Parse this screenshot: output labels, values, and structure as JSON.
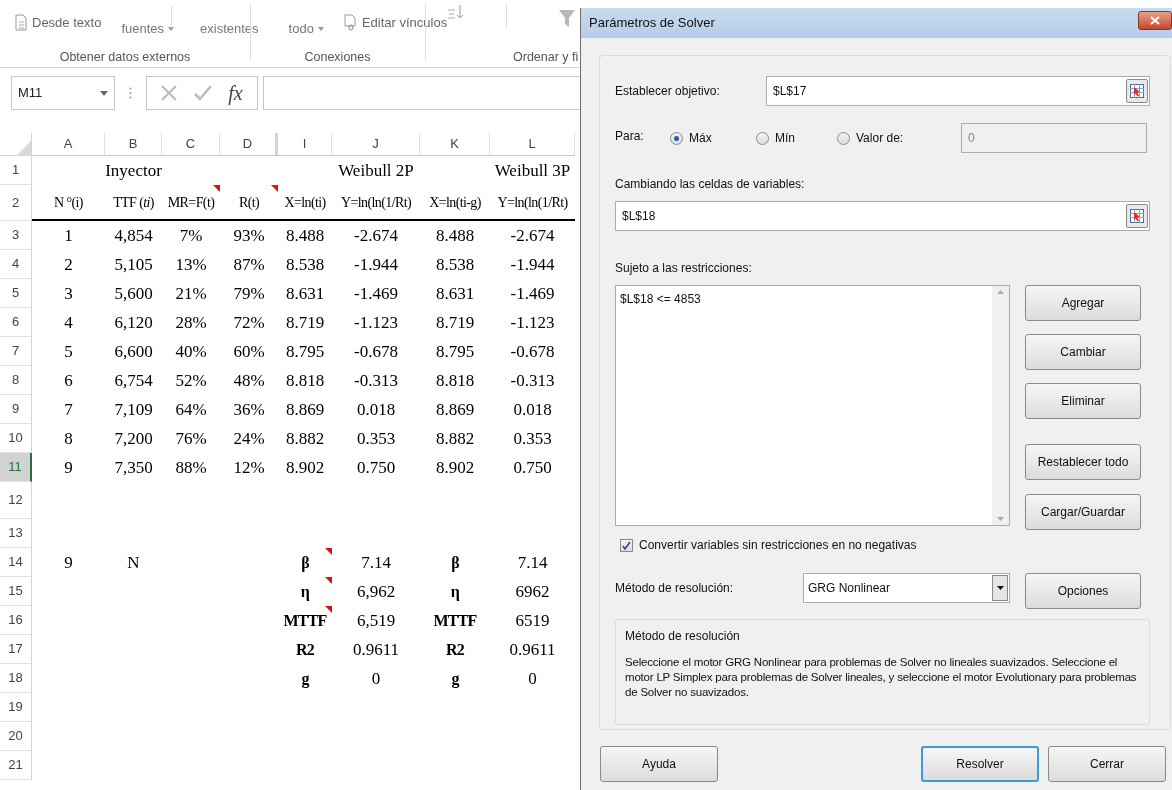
{
  "ribbon": {
    "items": [
      {
        "kind": "document",
        "label": "Desde texto"
      },
      {
        "kind": "dropdown",
        "label": "fuentes"
      },
      {
        "kind": "plain",
        "label": "existentes"
      },
      {
        "kind": "dropdown",
        "label": "todo"
      },
      {
        "kind": "link",
        "label": "Editar vínculos"
      },
      {
        "kind": "sort"
      },
      {
        "kind": "filter"
      }
    ],
    "groups": [
      "Obtener datos externos",
      "Conexiones",
      "Ordenar y fi"
    ]
  },
  "formula_bar": {
    "name_box": "M11",
    "function_symbol": "fx"
  },
  "sheet": {
    "columns": [
      "A",
      "B",
      "C",
      "D",
      "I",
      "J",
      "K",
      "L"
    ],
    "rows": [
      {
        "number": "1",
        "selected": false,
        "kind": "title",
        "cells": [
          "",
          "Inyector",
          "",
          "",
          "",
          "Weibull 2P",
          "",
          "Weibull 3P"
        ]
      },
      {
        "number": "2",
        "selected": false,
        "kind": "header",
        "cells": [
          "N °(i)",
          "TTF (*ti*)",
          {
            "text": "MR=F(t)",
            "kind": "commented"
          },
          {
            "text": "R(t)",
            "kind": "commented"
          },
          "X=ln(ti)",
          "Y=ln(ln(1/Rt)",
          "X=ln(ti-g)",
          "Y=ln(ln(1/Rt)"
        ]
      },
      {
        "number": "3",
        "selected": false,
        "kind": "data",
        "cells": [
          "1",
          "4,854",
          "7%",
          "93%",
          "8.488",
          "-2.674",
          "8.488",
          "-2.674"
        ]
      },
      {
        "number": "4",
        "selected": false,
        "kind": "data",
        "cells": [
          "2",
          "5,105",
          "13%",
          "87%",
          "8.538",
          "-1.944",
          "8.538",
          "-1.944"
        ]
      },
      {
        "number": "5",
        "selected": false,
        "kind": "data",
        "cells": [
          "3",
          "5,600",
          "21%",
          "79%",
          "8.631",
          "-1.469",
          "8.631",
          "-1.469"
        ]
      },
      {
        "number": "6",
        "selected": false,
        "kind": "data",
        "cells": [
          "4",
          "6,120",
          "28%",
          "72%",
          "8.719",
          "-1.123",
          "8.719",
          "-1.123"
        ]
      },
      {
        "number": "7",
        "selected": false,
        "kind": "data",
        "cells": [
          "5",
          "6,600",
          "40%",
          "60%",
          "8.795",
          "-0.678",
          "8.795",
          "-0.678"
        ]
      },
      {
        "number": "8",
        "selected": false,
        "kind": "data",
        "cells": [
          "6",
          "6,754",
          "52%",
          "48%",
          "8.818",
          "-0.313",
          "8.818",
          "-0.313"
        ]
      },
      {
        "number": "9",
        "selected": false,
        "kind": "data",
        "cells": [
          "7",
          "7,109",
          "64%",
          "36%",
          "8.869",
          "0.018",
          "8.869",
          "0.018"
        ]
      },
      {
        "number": "10",
        "selected": false,
        "kind": "data",
        "cells": [
          "8",
          "7,200",
          "76%",
          "24%",
          "8.882",
          "0.353",
          "8.882",
          "0.353"
        ]
      },
      {
        "number": "11",
        "selected": true,
        "kind": "data",
        "cells": [
          "9",
          "7,350",
          "88%",
          "12%",
          "8.902",
          "0.750",
          "8.902",
          "0.750"
        ]
      },
      {
        "number": "12",
        "selected": false,
        "kind": "empty"
      },
      {
        "number": "13",
        "selected": false,
        "kind": "empty"
      },
      {
        "number": "14",
        "selected": false,
        "kind": "summary",
        "cells": [
          "9",
          "N",
          "",
          "",
          {
            "text": "β",
            "kind": "commented"
          },
          "7.14",
          "β",
          "7.14"
        ]
      },
      {
        "number": "15",
        "selected": false,
        "kind": "summary",
        "cells": [
          "",
          "",
          "",
          "",
          {
            "text": "η",
            "kind": "commented"
          },
          "6,962",
          "η",
          "6962"
        ]
      },
      {
        "number": "16",
        "selected": false,
        "kind": "summary",
        "cells": [
          "",
          "",
          "",
          "",
          {
            "text": "MTTF",
            "kind": "commented"
          },
          "6,519",
          "MTTF",
          "6519"
        ]
      },
      {
        "number": "17",
        "selected": false,
        "kind": "summary",
        "cells": [
          "",
          "",
          "",
          "",
          "R2",
          "0.9611",
          "R2",
          "0.9611"
        ]
      },
      {
        "number": "18",
        "selected": false,
        "kind": "summary",
        "cells": [
          "",
          "",
          "",
          "",
          "g",
          "0",
          "g",
          "0"
        ]
      },
      {
        "number": "19",
        "selected": false,
        "kind": "empty"
      },
      {
        "number": "20",
        "selected": false,
        "kind": "empty"
      },
      {
        "number": "21",
        "selected": false,
        "kind": "empty"
      }
    ]
  },
  "dialog": {
    "title": "Parámetros de Solver",
    "objective": {
      "label": "Establecer objetivo:",
      "value": "$L$17"
    },
    "to": {
      "label": "Para:",
      "options": [
        {
          "label": "Máx",
          "selected": true
        },
        {
          "label": "Mín",
          "selected": false
        },
        {
          "label": "Valor de:",
          "selected": false
        }
      ],
      "value": "0",
      "disabled": true
    },
    "variables": {
      "label": "Cambiando las celdas de variables:",
      "value": "$L$18"
    },
    "constraints": {
      "label": "Sujeto a las restricciones:",
      "items": [
        "$L$18 <= 4853"
      ]
    },
    "constraint_buttons": [
      "Agregar",
      "Cambiar",
      "Eliminar",
      "Restablecer todo",
      "Cargar/Guardar"
    ],
    "nonnegative": {
      "label": "Convertir variables sin restricciones en no negativas",
      "checked": true
    },
    "method": {
      "label": "Método de resolución:",
      "value": "GRG Nonlinear",
      "button": "Opciones"
    },
    "method_info": {
      "title": "Método de resolución",
      "text": "Seleccione el motor GRG Nonlinear para problemas de Solver no lineales suavizados. Seleccione el motor LP Simplex para problemas de Solver lineales, y seleccione el motor Evolutionary para problemas de Solver no suavizados."
    },
    "footer_buttons": [
      {
        "label": "Ayuda",
        "focused": false
      },
      {
        "label": "Resolver",
        "focused": true
      },
      {
        "label": "Cerrar",
        "focused": false
      }
    ]
  }
}
